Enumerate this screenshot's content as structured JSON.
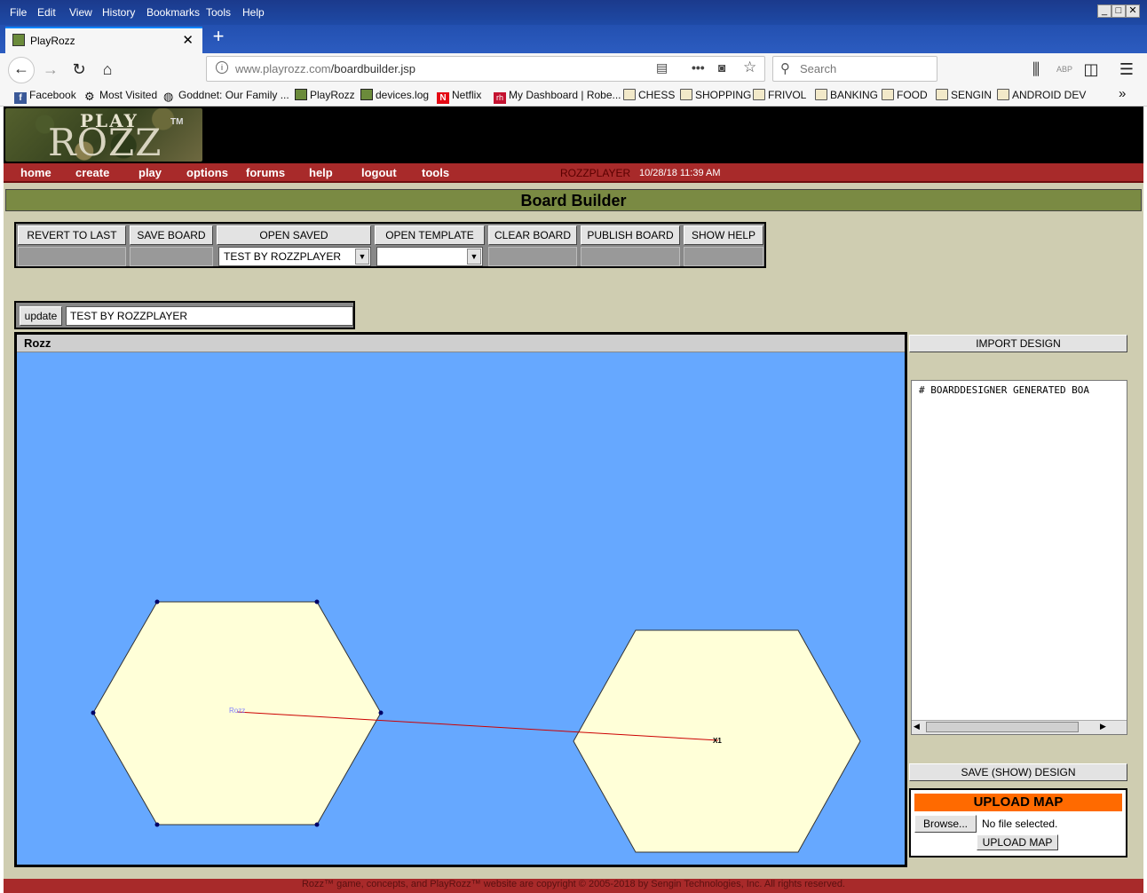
{
  "browser": {
    "menu": [
      "File",
      "Edit",
      "View",
      "History",
      "Bookmarks",
      "Tools",
      "Help"
    ],
    "tab_title": "PlayRozz",
    "url_domain": "www.playrozz.com",
    "url_path": "/boardbuilder.jsp",
    "search_placeholder": "Search",
    "bookmarks": [
      {
        "label": "Facebook",
        "icon": "facebook-icon"
      },
      {
        "label": "Most Visited",
        "icon": "gear-icon"
      },
      {
        "label": "Goddnet: Our Family ...",
        "icon": "globe-icon"
      },
      {
        "label": "PlayRozz",
        "icon": "playrozz-icon"
      },
      {
        "label": "devices.log",
        "icon": "playrozz-icon"
      },
      {
        "label": "Netflix",
        "icon": "netflix-icon"
      },
      {
        "label": "My Dashboard | Robe...",
        "icon": "rh-icon"
      },
      {
        "label": "CHESS",
        "icon": "folder-icon"
      },
      {
        "label": "SHOPPING",
        "icon": "folder-icon"
      },
      {
        "label": "FRIVOL",
        "icon": "folder-icon"
      },
      {
        "label": "BANKING",
        "icon": "folder-icon"
      },
      {
        "label": "FOOD",
        "icon": "folder-icon"
      },
      {
        "label": "SENGIN",
        "icon": "folder-icon"
      },
      {
        "label": "ANDROID DEV",
        "icon": "folder-icon"
      }
    ]
  },
  "site": {
    "logo_play": "PLAY",
    "logo_rozz": "ROZZ",
    "logo_tm": "TM",
    "nav": [
      "home",
      "create",
      "play",
      "options",
      "forums",
      "help",
      "logout",
      "tools"
    ],
    "user": "ROZZPLAYER",
    "datetime": "10/28/18 11:39 AM",
    "page_title": "Board Builder",
    "footer": "Rozz™ game, concepts, and PlayRozz™ website are copyright © 2005-2018 by Sengin Technologies, Inc. All rights reserved."
  },
  "toolbar": {
    "revert": "REVERT TO LAST",
    "save": "SAVE BOARD",
    "open_saved": "OPEN SAVED",
    "open_template": "OPEN TEMPLATE",
    "clear": "CLEAR BOARD",
    "publish": "PUBLISH BOARD",
    "show_help": "SHOW HELP",
    "saved_selected": "TEST BY ROZZPLAYER",
    "template_selected": ""
  },
  "name_form": {
    "update": "update",
    "name_value": "TEST BY ROZZPLAYER"
  },
  "board": {
    "title": "Rozz",
    "label_a": "Rozz",
    "label_b": "X1",
    "water_color": "#66a8ff",
    "land_color": "#ffffd8",
    "link_color": "#cc0000"
  },
  "panel": {
    "import": "IMPORT DESIGN",
    "design_text": "# BOARDDESIGNER GENERATED BOA",
    "save_show": "SAVE (SHOW) DESIGN",
    "upload_title": "UPLOAD MAP",
    "browse": "Browse...",
    "file_status": "No file selected.",
    "upload_button": "UPLOAD MAP"
  }
}
